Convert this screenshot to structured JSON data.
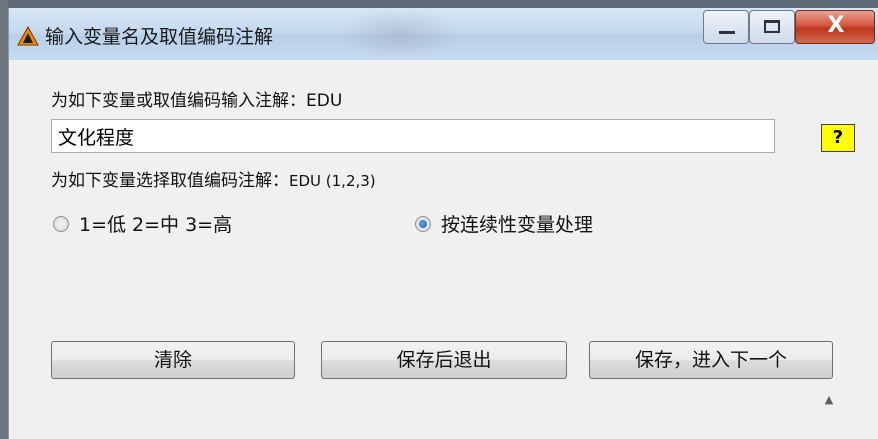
{
  "window": {
    "title": "输入变量名及取值编码注解",
    "controls": {
      "minimize": "minimize",
      "maximize": "maximize",
      "close": "X"
    }
  },
  "annotation": {
    "prompt_prefix": "为如下变量或取值编码输入注解：",
    "variable": "EDU",
    "input_value": "文化程度",
    "help_label": "?"
  },
  "coding": {
    "prompt_prefix": "为如下变量选择取值编码注解：",
    "variable_codes": "EDU (1,2,3)",
    "options": [
      {
        "label": "1=低 2=中 3=高",
        "selected": false
      },
      {
        "label": "按连续性变量处理",
        "selected": true
      }
    ]
  },
  "buttons": {
    "clear": "清除",
    "save_exit": "保存后退出",
    "save_next": "保存，进入下一个"
  },
  "icons": {
    "app": "warning-triangle-icon",
    "scroll": "scroll-up-icon"
  }
}
